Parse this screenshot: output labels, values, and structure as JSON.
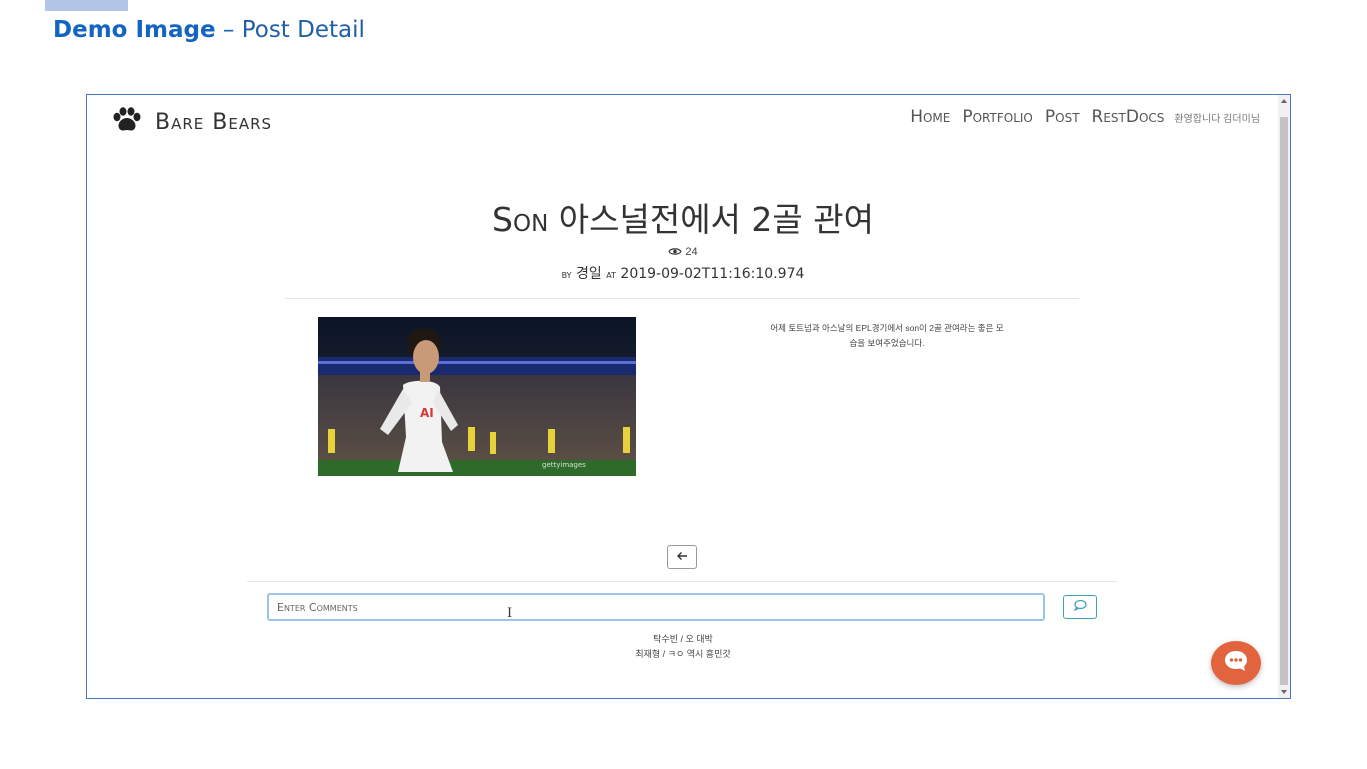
{
  "slide": {
    "title_strong": "Demo Image",
    "title_sep": " – ",
    "title_rest": "Post Detail"
  },
  "navbar": {
    "brand": "Bare Bears",
    "links": [
      "Home",
      "Portfolio",
      "Post",
      "RestDocs"
    ],
    "welcome": "환영합니다 김더미님"
  },
  "post": {
    "title": "Son 아스널전에서 2골 관여",
    "views": "24",
    "by_label": "by",
    "author": "경일",
    "at_label": "at",
    "date": "2019-09-02T11:16:10.974",
    "body_line1": "어제 토트넘과 아스날의 EPL경기에서 son이 2골 관여라는 좋은 모",
    "body_line2": "습을 보여주었습니다.",
    "photo_watermark": "gettyimages"
  },
  "comment_form": {
    "placeholder": "Enter Comments"
  },
  "comments": [
    {
      "author": "탁수빈",
      "text": "오 대박"
    },
    {
      "author": "최재형",
      "text": "ㅋㅇ 역시 흥민갓"
    }
  ],
  "colors": {
    "slide_title": "#1565c0",
    "frame_border": "#4a78c0",
    "chat_button": "#e2643f",
    "input_border": "#9ec3e6"
  },
  "icons": {
    "brand": "paw-icon",
    "views": "eye-icon",
    "back": "arrow-left-icon",
    "submit": "speech-bubble-icon",
    "chat": "chat-icon"
  }
}
